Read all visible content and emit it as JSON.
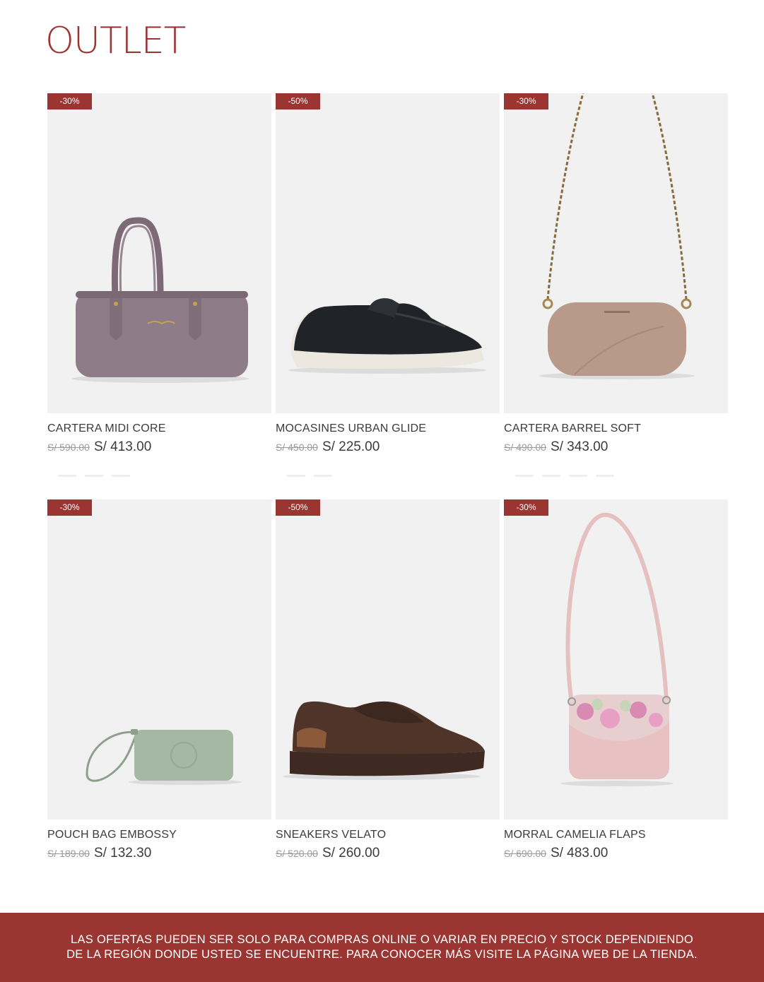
{
  "page": {
    "title": "OUTLET"
  },
  "products": [
    {
      "name": "CARTERA MIDI CORE",
      "discount": "-30%",
      "price_old": "S/ 590.00",
      "price_new": "S/ 413.00",
      "image": "lilac-handbag"
    },
    {
      "name": "MOCASINES URBAN GLIDE",
      "discount": "-50%",
      "price_old": "S/ 450.00",
      "price_new": "S/ 225.00",
      "image": "black-loafer"
    },
    {
      "name": "CARTERA BARREL SOFT",
      "discount": "-30%",
      "price_old": "S/ 490.00",
      "price_new": "S/ 343.00",
      "image": "beige-barrel-bag"
    },
    {
      "name": "POUCH BAG EMBOSSY",
      "discount": "-30%",
      "price_old": "S/ 189.00",
      "price_new": "S/ 132.30",
      "image": "green-wristlet"
    },
    {
      "name": "SNEAKERS VELATO",
      "discount": "-50%",
      "price_old": "S/ 520.00",
      "price_new": "S/ 260.00",
      "image": "brown-sneaker"
    },
    {
      "name": "MORRAL CAMELIA FLAPS",
      "discount": "-30%",
      "price_old": "S/ 690.00",
      "price_new": "S/ 483.00",
      "image": "pink-floral-crossbody"
    }
  ],
  "footer": {
    "line1": "LAS OFERTAS PUEDEN SER SOLO PARA COMPRAS ONLINE O VARIAR EN PRECIO Y STOCK DEPENDIENDO",
    "line2": "DE LA REGIÓN DONDE USTED SE ENCUENTRE. PARA CONOCER MÁS VISITE LA PÁGINA WEB DE LA TIENDA."
  },
  "colors": {
    "accent": "#9a3532",
    "card_bg": "#f1f1f1"
  }
}
